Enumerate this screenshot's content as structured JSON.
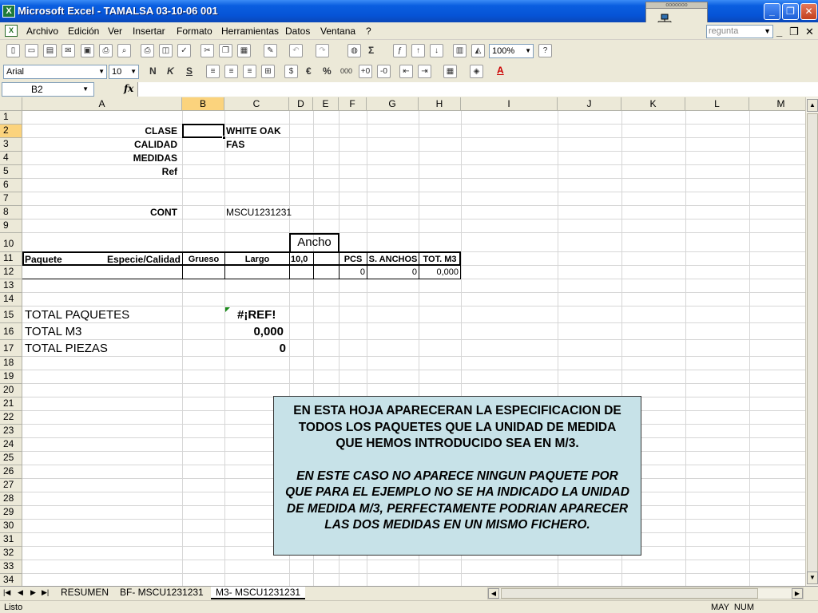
{
  "window": {
    "title": "Microsoft Excel - TAMALSA 03-10-06 001",
    "app_icon": "excel-icon"
  },
  "menu": {
    "items": [
      "Archivo",
      "Edición",
      "Ver",
      "Insertar",
      "Formato",
      "Herramientas",
      "Datos",
      "Ventana",
      "?"
    ],
    "help_placeholder": "regunta"
  },
  "toolbar": {
    "zoom": "100%",
    "font_name": "Arial",
    "font_size": "10",
    "sigma": "Σ",
    "euro": "€",
    "percent": "%",
    "thousands": "000",
    "bold_btn": "N",
    "italic_btn": "K",
    "underline_btn": "S",
    "fill_btn": "A"
  },
  "formula_bar": {
    "name_box": "B2",
    "fx_label": "fx",
    "content": ""
  },
  "grid": {
    "columns": [
      "A",
      "B",
      "C",
      "D",
      "E",
      "F",
      "G",
      "H",
      "I",
      "J",
      "K",
      "L",
      "M"
    ],
    "rows": [
      "1",
      "2",
      "3",
      "4",
      "5",
      "6",
      "7",
      "8",
      "9",
      "10",
      "11",
      "12",
      "13",
      "14",
      "15",
      "16",
      "17",
      "18",
      "19",
      "20",
      "21",
      "22",
      "23",
      "24",
      "25",
      "26",
      "27",
      "28",
      "29",
      "30",
      "31",
      "32",
      "33",
      "34"
    ],
    "selected_cell": "B2"
  },
  "cells": {
    "a2": "CLASE",
    "c2": "WHITE OAK",
    "a3": "CALIDAD",
    "c3": "FAS",
    "a4": "MEDIDAS",
    "a5": "Ref",
    "a8": "CONT",
    "c8": "MSCU1231231",
    "d10": "Ancho",
    "a11_left": "Paquete",
    "a11_right": "Especie/Calidad",
    "b11": "Grueso",
    "c11": "Largo",
    "d11": "10,0",
    "f11": "PCS",
    "g11": "S. ANCHOS",
    "h11": "TOT. M3",
    "f12": "0",
    "g12": "0",
    "h12": "0,000",
    "a15": "TOTAL PAQUETES",
    "c15": "#¡REF!",
    "a16": "TOTAL M3",
    "c16": "0,000",
    "a17": "TOTAL PIEZAS",
    "c17": "0"
  },
  "note": {
    "paragraph1": "EN ESTA HOJA APARECERAN LA ESPECIFICACION DE TODOS LOS PAQUETES QUE LA UNIDAD DE MEDIDA QUE HEMOS INTRODUCIDO SEA EN M/3.",
    "paragraph2": "EN ESTE CASO NO APARECE NINGUN PAQUETE POR QUE PARA EL EJEMPLO NO SE HA INDICADO LA UNIDAD DE MEDIDA M/3, PERFECTAMENTE PODRIAN APARECER LAS DOS MEDIDAS EN UN MISMO FICHERO."
  },
  "sheet_tabs": [
    "RESUMEN",
    "BF- MSCU1231231",
    "M3- MSCU1231231"
  ],
  "active_sheet": "M3- MSCU1231231",
  "status": {
    "left": "Listo",
    "right": "MAY  NUM"
  },
  "colors": {
    "titlebar": "#0653d6",
    "note_bg": "#c7e2e8",
    "header_selected": "#fbd37d"
  }
}
